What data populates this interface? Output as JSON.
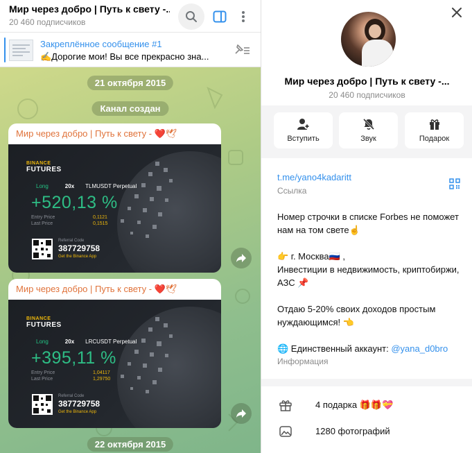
{
  "chat": {
    "title": "Мир через добро | Путь к свету -...",
    "subscribers": "20 460 подписчиков",
    "pinned": {
      "title": "Закреплённое сообщение #1",
      "text": "✍️Дорогие мои! Вы все прекрасно зна..."
    },
    "date_1": "21 октября 2015",
    "service": "Канал создан",
    "date_2": "22 октября 2015",
    "messages": [
      {
        "author": "Мир через добро | Путь к свету -",
        "author_emoji": "❤️🕊",
        "card": {
          "brand_top": "BINANCE",
          "brand_bottom": "FUTURES",
          "side": "Long",
          "leverage": "20x",
          "pair": "TLMUSDT Perpetual",
          "pnl": "+520,13 %",
          "entry_label": "Entry Price",
          "last_label": "Last Price",
          "entry": "0,1121",
          "last": "0,1515",
          "ref_label": "Referral Code",
          "ref_code": "387729758",
          "get_app": "Get the Binance App"
        }
      },
      {
        "author": "Мир через добро | Путь к свету -",
        "author_emoji": "❤️🕊",
        "card": {
          "brand_top": "BINANCE",
          "brand_bottom": "FUTURES",
          "side": "Long",
          "leverage": "20x",
          "pair": "LRCUSDT Perpetual",
          "pnl": "+395,11 %",
          "entry_label": "Entry Price",
          "last_label": "Last Price",
          "entry": "1,04117",
          "last": "1,29750",
          "ref_label": "Referral Code",
          "ref_code": "387729758",
          "get_app": "Get the Binance App"
        }
      }
    ]
  },
  "panel": {
    "name": "Мир через добро | Путь к свету -...",
    "subscribers": "20 460 подписчиков",
    "actions": [
      {
        "label": "Вступить",
        "icon": "add-user-icon"
      },
      {
        "label": "Звук",
        "icon": "bell-muted-icon"
      },
      {
        "label": "Подарок",
        "icon": "gift-icon"
      }
    ],
    "link": "t.me/yano4kadaritt",
    "link_label": "Ссылка",
    "description": {
      "p1": "Номер строчки в списке Forbes не поможет нам на том свете☝️",
      "p2": "👉 г. Москва🇷🇺 ,\nИнвестиции в недвижимость, криптобиржи, АЗС 📌",
      "p3": "Отдаю 5-20% своих доходов простым нуждающимся! 👈",
      "p4_prefix": "🌐 Единственный аккаунт: ",
      "p4_mention": "@yana_d0bro"
    },
    "description_label": "Информация",
    "gifts": "4 подарка 🎁🎁💝",
    "photos": "1280 фотографий"
  },
  "colors": {
    "accent": "#3390ec",
    "author": "#e0733b",
    "binance_yellow": "#f0b90b",
    "profit_green": "#2ebd85"
  }
}
